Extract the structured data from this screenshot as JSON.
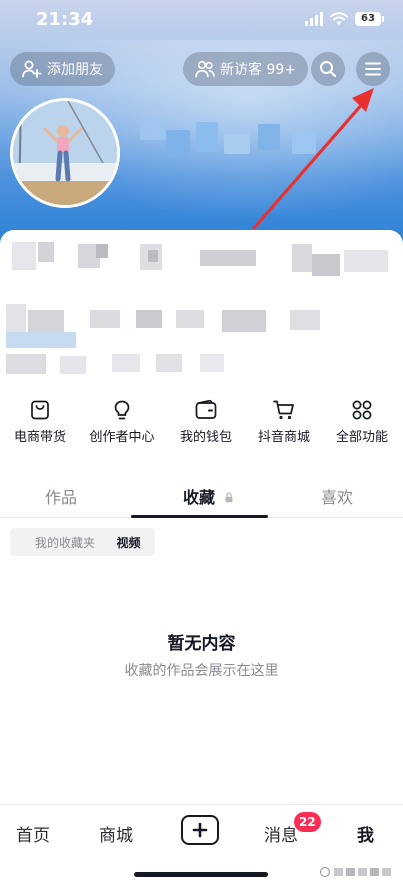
{
  "status_bar": {
    "time": "21:34",
    "battery": "63"
  },
  "header": {
    "add_friend_label": "添加朋友",
    "visitor_label": "新访客 99+"
  },
  "quick_actions": [
    {
      "label": "电商带货",
      "icon": "shopping-bag-icon"
    },
    {
      "label": "创作者中心",
      "icon": "lightbulb-icon"
    },
    {
      "label": "我的钱包",
      "icon": "wallet-icon"
    },
    {
      "label": "抖音商城",
      "icon": "cart-icon"
    },
    {
      "label": "全部功能",
      "icon": "grid-icon"
    }
  ],
  "tabs": [
    {
      "label": "作品",
      "active": false
    },
    {
      "label": "收藏",
      "active": true,
      "locked": true
    },
    {
      "label": "喜欢",
      "active": false
    }
  ],
  "filters": {
    "folder_label": "我的收藏夹",
    "video_label": "视频"
  },
  "empty_state": {
    "title": "暂无内容",
    "subtitle": "收藏的作品会展示在这里"
  },
  "bottom_nav": {
    "home": "首页",
    "mall": "商城",
    "messages": "消息",
    "messages_badge": "22",
    "me": "我"
  },
  "colors": {
    "accent_red": "#fe2c55",
    "annotation_arrow": "#e8312f",
    "header_blue": "#2a7fd6"
  }
}
